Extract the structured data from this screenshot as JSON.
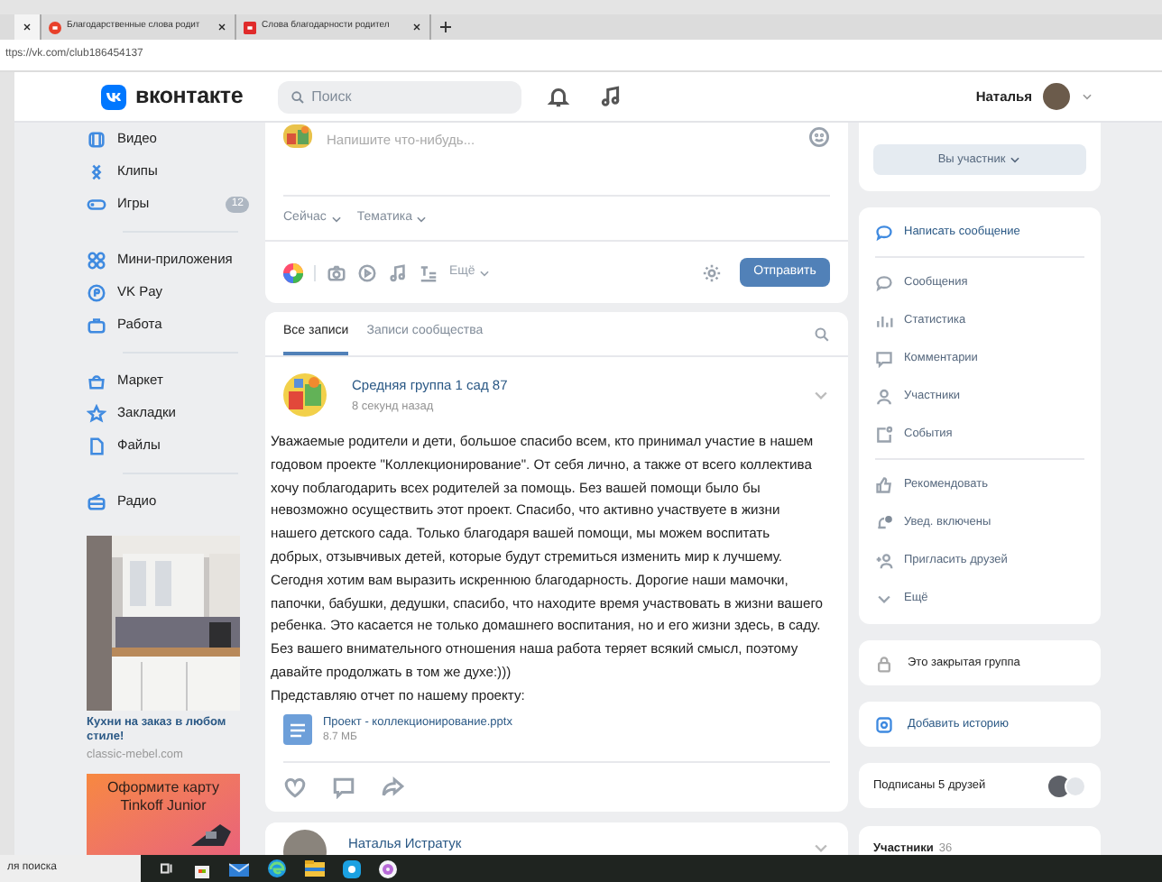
{
  "browser": {
    "tabs": [
      {
        "selected": true
      },
      {
        "title": "Благодарственные слова родит",
        "selected": false
      },
      {
        "title": "Слова благодарности родител",
        "selected": false
      }
    ],
    "address": "ttps://vk.com/club186454137"
  },
  "header": {
    "logo": "вконтакте",
    "search_placeholder": "Поиск",
    "user": "Наталья"
  },
  "nav": {
    "groups": [
      [
        {
          "label": "Видео"
        },
        {
          "label": "Клипы"
        },
        {
          "label": "Игры",
          "badge": "12"
        }
      ],
      [
        {
          "label": "Мини-приложения"
        },
        {
          "label": "VK Pay"
        },
        {
          "label": "Работа"
        }
      ],
      [
        {
          "label": "Маркет"
        },
        {
          "label": "Закладки"
        },
        {
          "label": "Файлы"
        }
      ],
      [
        {
          "label": "Радио"
        }
      ]
    ],
    "ads": [
      {
        "title": "Кухни на заказ в любом стиле!",
        "domain": "classic-mebel.com"
      },
      {
        "kind": "banner",
        "title": "Оформите карту Tinkoff Junior"
      }
    ]
  },
  "composer": {
    "placeholder": "Напишите что-нибудь...",
    "options": [
      "Сейчас",
      "Тематика"
    ],
    "more": "Ещё",
    "submit": "Отправить"
  },
  "wall": {
    "tabs": [
      {
        "label": "Все записи",
        "selected": true
      },
      {
        "label": "Записи сообщества",
        "selected": false
      }
    ],
    "posts": [
      {
        "author": "Средняя группа 1 сад 87",
        "time": "8 секунд назад",
        "paragraphs": [
          "Уважаемые родители и дети, большое спасибо всем, кто принимал участие в нашем годовом проекте \"Коллекционирование\". От себя лично, а также от всего коллектива хочу поблагодарить всех родителей за помощь. Без вашей помощи было бы невозможно осуществить этот проект. Спасибо, что активно участвуете в жизни нашего детского сада. Только благодаря вашей помощи, мы можем воспитать добрых, отзывчивых детей, которые будут стремиться изменить мир к лучшему.",
          "Сегодня хотим вам выразить искреннюю благодарность. Дорогие наши мамочки, папочки, бабушки, дедушки, спасибо, что находите время участвовать в жизни вашего ребенка. Это касается не только домашнего воспитания, но и его жизни здесь, в саду. Без вашего внимательного отношения наша работа теряет всякий смысл, поэтому давайте продолжать в том же духе:)))",
          "Представляю отчет по нашему проекту:"
        ],
        "attachment": {
          "name": "Проект - коллекционирование.pptx",
          "size": "8.7 МБ"
        }
      },
      {
        "author": "Наталья Истратук"
      }
    ]
  },
  "side": {
    "membership": "Вы участник",
    "primary_action": "Написать сообщение",
    "menu_groups": [
      [
        "Сообщения",
        "Статистика",
        "Комментарии",
        "Участники",
        "События"
      ],
      [
        "Рекомендовать",
        "Увед. включены",
        "Пригласить друзей",
        "Ещё"
      ]
    ],
    "closed_group": "Это закрытая группа",
    "add_story": "Добавить историю",
    "friends": "Подписаны 5 друзей",
    "members": {
      "label": "Участники",
      "count": "36"
    }
  },
  "taskbar": {
    "search": "ля поиска"
  }
}
